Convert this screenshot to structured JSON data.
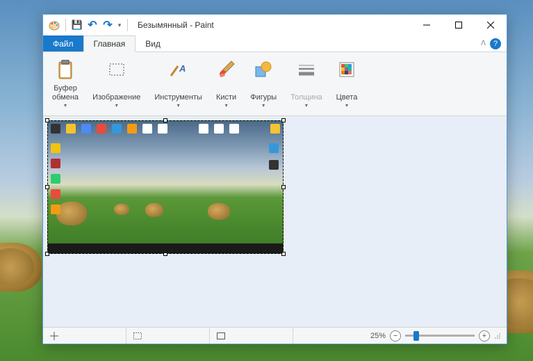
{
  "window": {
    "title": "Безымянный - Paint"
  },
  "tabs": {
    "file": "Файл",
    "home": "Главная",
    "view": "Вид"
  },
  "ribbon": {
    "clipboard": "Буфер\nобмена",
    "image": "Изображение",
    "tools": "Инструменты",
    "brushes": "Кисти",
    "shapes": "Фигуры",
    "size": "Толщина",
    "colors": "Цвета"
  },
  "status": {
    "zoom_label": "25%"
  },
  "icons": {
    "save": "💾",
    "undo": "↶",
    "redo": "↷"
  }
}
